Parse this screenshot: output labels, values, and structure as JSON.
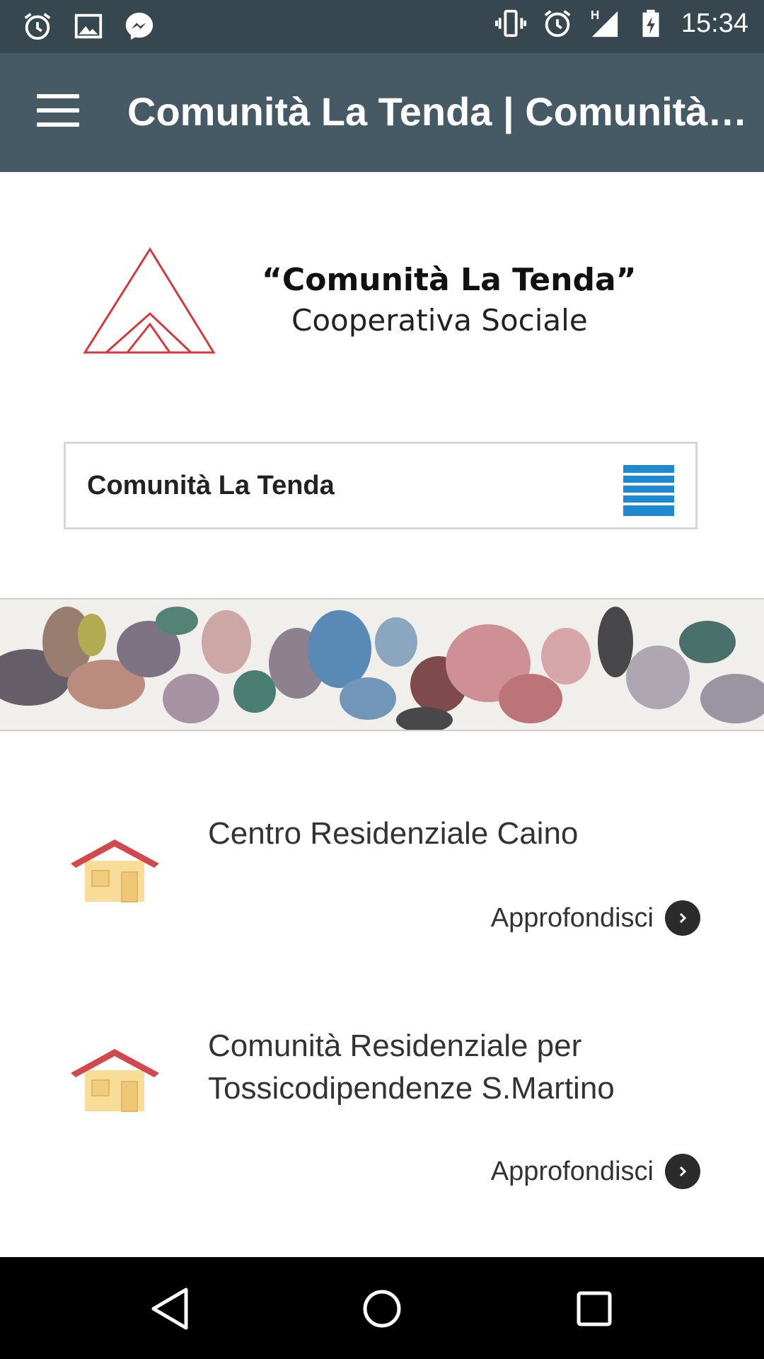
{
  "status_bar": {
    "time": "15:34",
    "left_icons": [
      "alarm-icon",
      "image-icon",
      "messenger-icon"
    ],
    "right_icons": [
      "vibrate-icon",
      "alarm-icon",
      "signal-h-icon",
      "battery-charging-icon"
    ],
    "network_label": "H"
  },
  "app_bar": {
    "title": "Comunità La Tenda | Comunità ...",
    "menu_icon": "hamburger-menu-icon"
  },
  "logo": {
    "line1": "“Comunità La Tenda”",
    "line2": "Cooperativa Sociale"
  },
  "site_menu": {
    "label": "Comunità La Tenda",
    "icon": "list-menu-icon"
  },
  "items": [
    {
      "title": "Centro Residenziale Caino",
      "link_label": "Approfondisci",
      "icon": "house-icon"
    },
    {
      "title": "Comunità Residenziale per Tossicodipendenze S.Martino",
      "link_label": "Approfondisci",
      "icon": "house-icon"
    }
  ],
  "nav_bar": {
    "buttons": [
      "back-icon",
      "home-icon",
      "recents-icon"
    ]
  },
  "colors": {
    "status_bar": "#37474f",
    "app_bar": "#455a64",
    "menu_icon_blue": "#1e88d0",
    "house_roof": "#d2484c",
    "house_wall": "#f7dd97"
  }
}
